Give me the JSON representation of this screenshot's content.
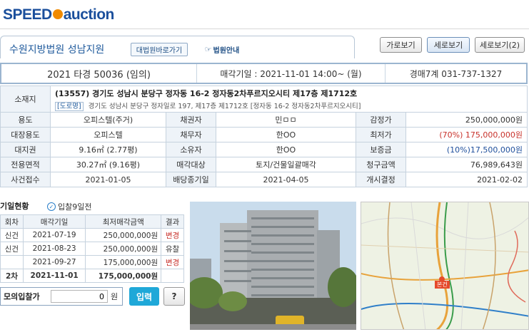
{
  "logo": {
    "speed": "SPEED",
    "auction": "auction"
  },
  "court": {
    "name": "수원지방법원 성남지원",
    "btn_court_link": "대법원바로가기",
    "btn_court_info": "법원안내"
  },
  "view": {
    "horizontal": "가로보기",
    "vertical": "세로보기",
    "vertical2": "세로보기(2)"
  },
  "case": {
    "number": "2021 타경 50036 (임의)",
    "sale_date": "매각기일 : 2021-11-01 14:00~ (월)",
    "dept": "경매7계 031-737-1327"
  },
  "info": {
    "address_label": "소재지",
    "address": "(13557) 경기도 성남시 분당구 정자동 16-2 정자동2차푸르지오시티 제17층 제1712호",
    "road_tag": "[도로명]",
    "road_address": "경기도 성남시 분당구 정자일로 197, 제17층 제1712호 [정자동 16-2 정자동2차푸르지오시티]",
    "rows": [
      [
        "용도",
        "오피스텔(주거)",
        "채권자",
        "민ㅁㅁ",
        "감정가",
        "250,000,000원"
      ],
      [
        "대장용도",
        "오피스텔",
        "채무자",
        "한OO",
        "최저가",
        "(70%) 175,000,000원"
      ],
      [
        "대지권",
        "9.16㎡ (2.77평)",
        "소유자",
        "한OO",
        "보증금",
        "(10%)17,500,000원"
      ],
      [
        "전용면적",
        "30.27㎡ (9.16평)",
        "매각대상",
        "토지/건물일괄매각",
        "청구금액",
        "76,989,643원"
      ],
      [
        "사건접수",
        "2021-01-05",
        "배당종기일",
        "2021-04-05",
        "개시결정",
        "2021-02-02"
      ]
    ]
  },
  "history": {
    "title": "기일현황",
    "checkbox_label": "입찰9일전",
    "headers": [
      "회차",
      "매각기일",
      "최저매각금액",
      "결과"
    ],
    "rows": [
      [
        "신건",
        "2021-07-19",
        "250,000,000원",
        "변경"
      ],
      [
        "신건",
        "2021-08-23",
        "250,000,000원",
        "유찰"
      ],
      [
        "",
        "2021-09-27",
        "175,000,000원",
        "변경"
      ],
      [
        "2차",
        "2021-11-01",
        "175,000,000원",
        ""
      ]
    ]
  },
  "mock_bid": {
    "label": "모의입찰가",
    "value": "0",
    "unit": "원",
    "submit": "입력",
    "help": "?"
  },
  "map": {
    "marker": "본건"
  },
  "colors": {
    "brand": "#1b4f9c",
    "accent": "#f08a00",
    "red": "#c8312a",
    "button": "#1fa8d8"
  }
}
